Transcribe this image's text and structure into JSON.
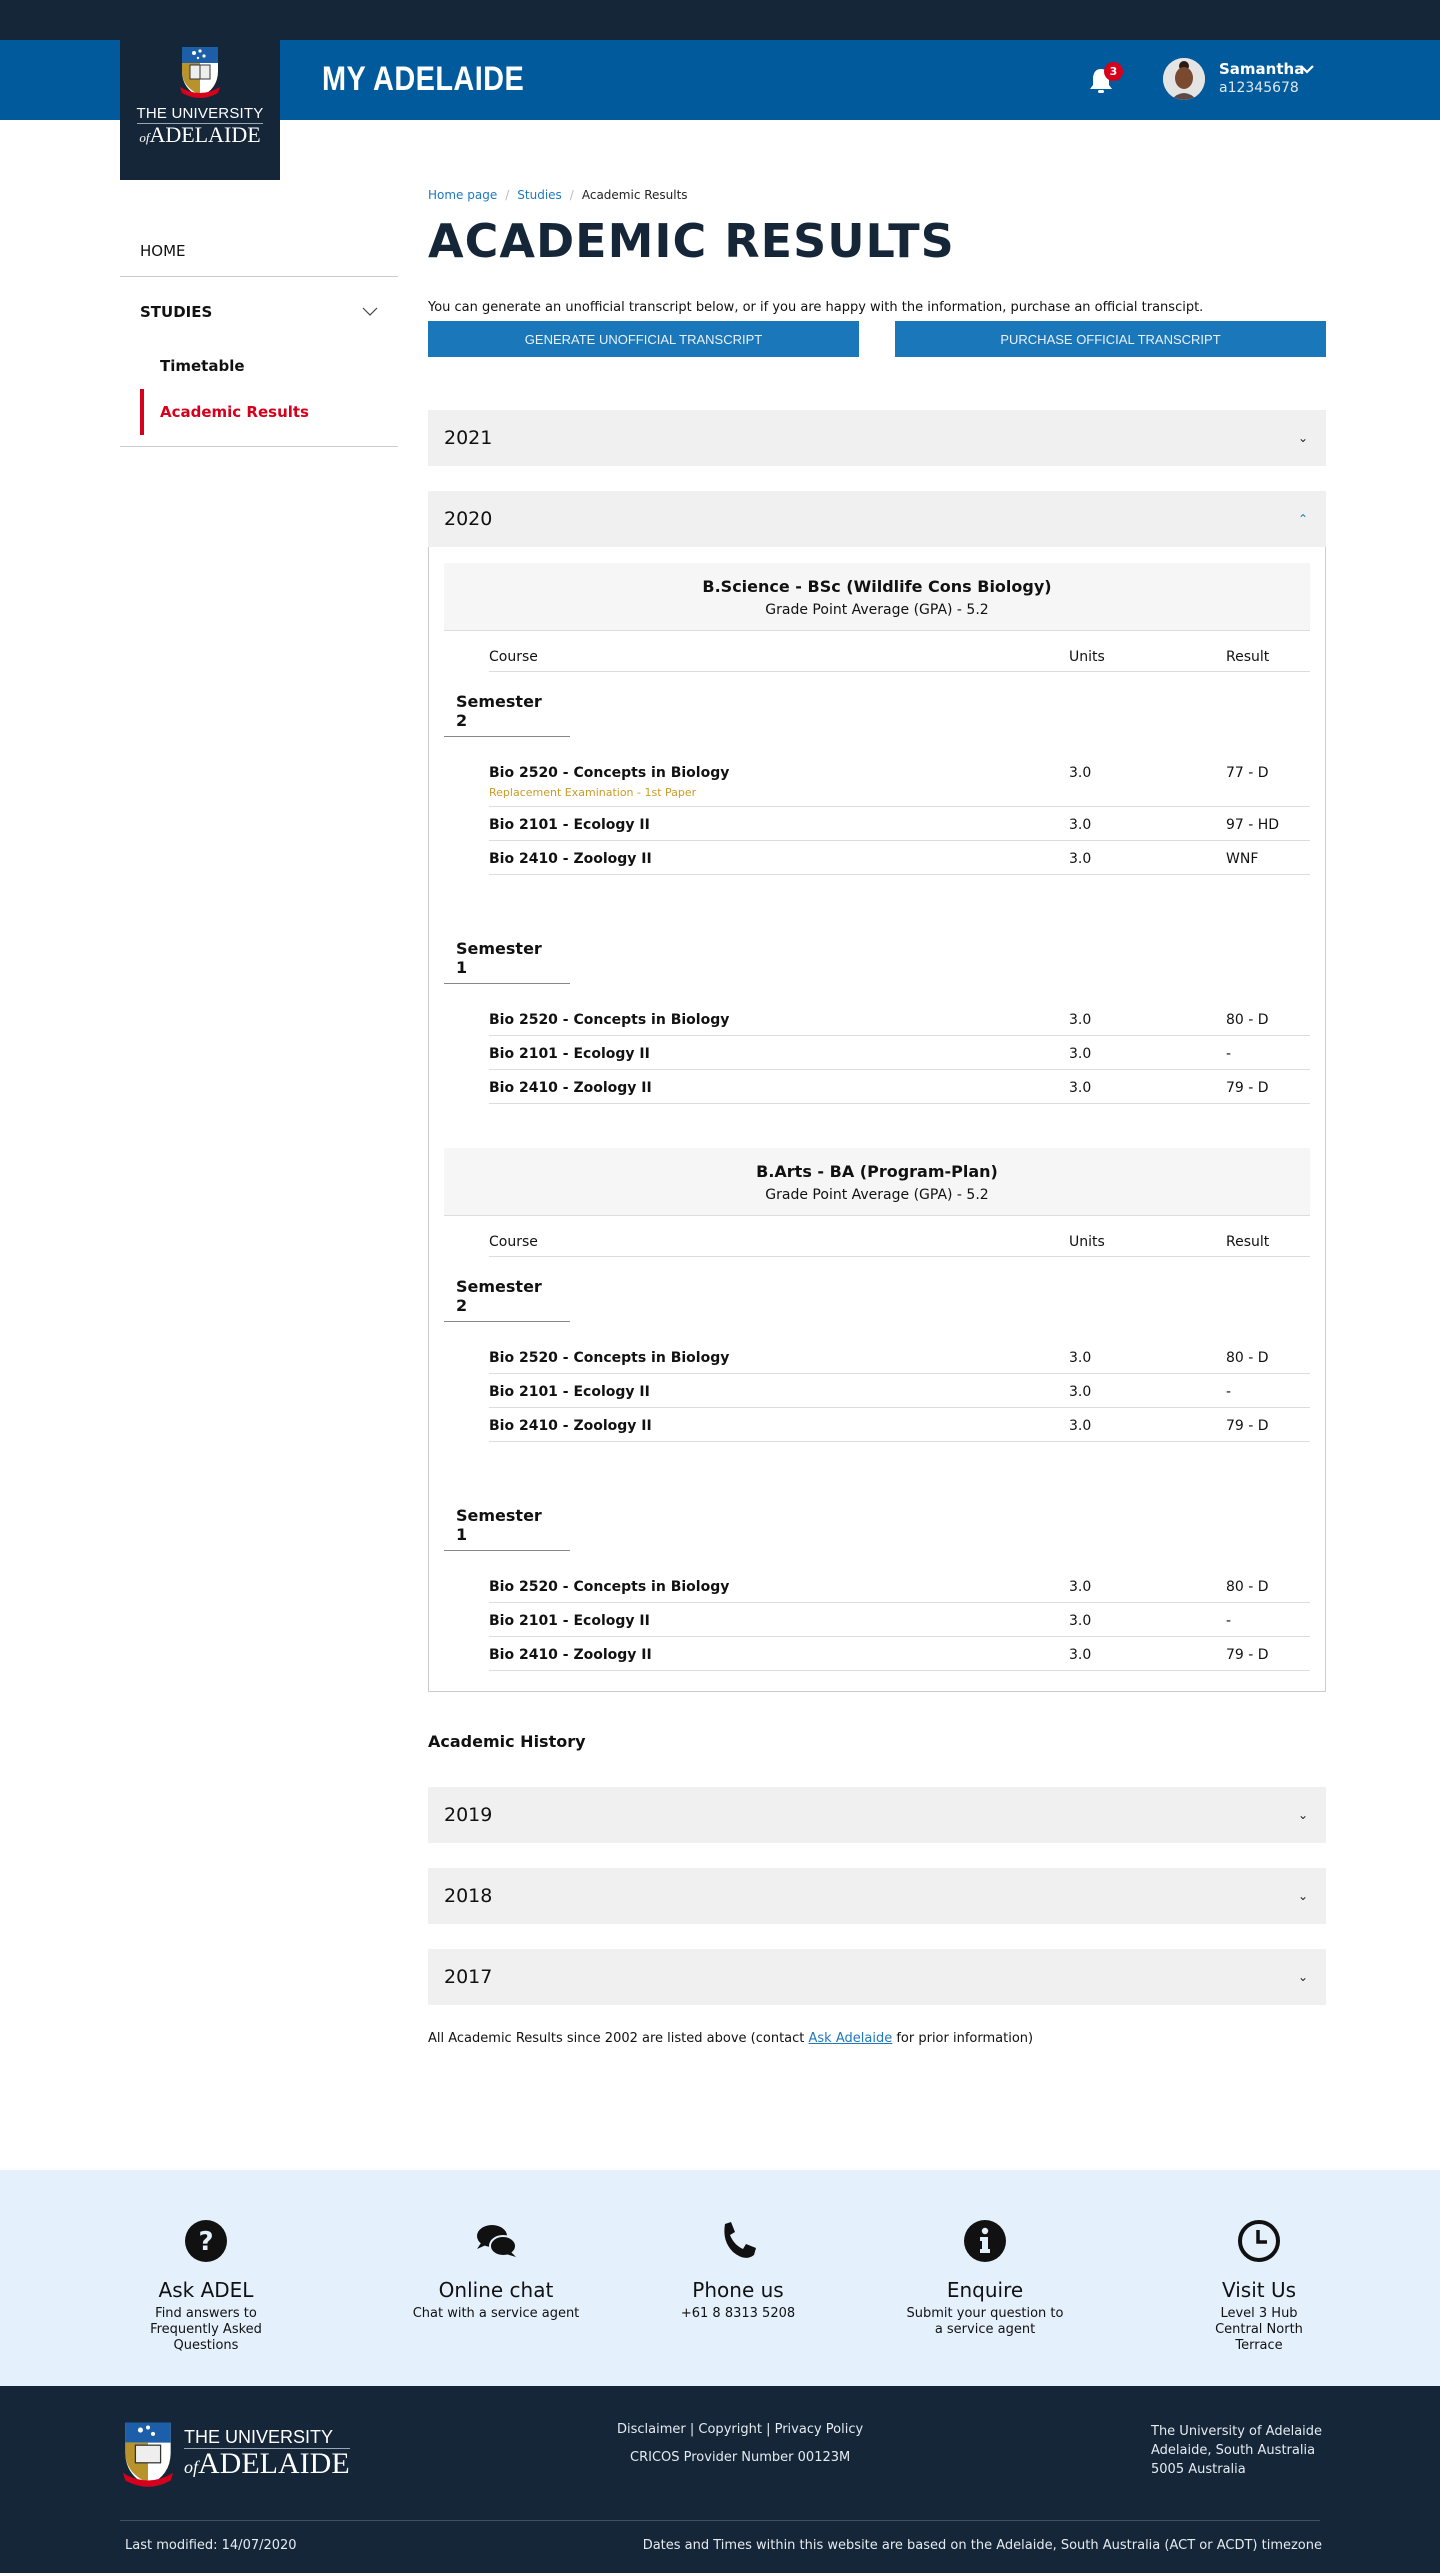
{
  "header": {
    "logo_line1": "THE UNIVERSITY",
    "logo_of": "of",
    "logo_line2": "ADELAIDE",
    "site_title": "MY ADELAIDE",
    "notification_count": "3",
    "user_name": "Samantha",
    "user_id": "a12345678"
  },
  "sidebar": {
    "home": "HOME",
    "studies": "STUDIES",
    "items": [
      {
        "label": "Timetable",
        "active": false
      },
      {
        "label": "Academic Results",
        "active": true
      }
    ]
  },
  "breadcrumb": [
    "Home page",
    "Studies",
    "Academic Results"
  ],
  "page_title": "ACADEMIC RESULTS",
  "intro": "You can generate an unofficial transcript below, or if you are happy with the information, purchase an official transcipt.",
  "buttons": {
    "generate": "GENERATE UNOFFICIAL TRANSCRIPT",
    "purchase": "PURCHASE OFFICIAL TRANSCRIPT"
  },
  "years": {
    "y2021": "2021",
    "y2020": "2020"
  },
  "table_headers": {
    "course": "Course",
    "units": "Units",
    "result": "Result"
  },
  "programs": [
    {
      "name": "B.Science - BSc (Wildlife Cons Biology)",
      "gpa": "Grade Point Average (GPA) - 5.2",
      "semesters": [
        {
          "title": "Semester 2",
          "courses": [
            {
              "name": "Bio 2520 - Concepts in Biology",
              "note": "Replacement Examination - 1st Paper",
              "units": "3.0",
              "result": "77 - D"
            },
            {
              "name": "Bio 2101 - Ecology II",
              "units": "3.0",
              "result": "97 - HD"
            },
            {
              "name": "Bio 2410 - Zoology II",
              "units": "3.0",
              "result": "WNF"
            }
          ]
        },
        {
          "title": "Semester 1",
          "courses": [
            {
              "name": "Bio 2520 - Concepts in Biology",
              "units": "3.0",
              "result": "80 - D"
            },
            {
              "name": "Bio 2101 - Ecology II",
              "units": "3.0",
              "result": "-"
            },
            {
              "name": "Bio 2410 - Zoology II",
              "units": "3.0",
              "result": "79 - D"
            }
          ]
        }
      ]
    },
    {
      "name": "B.Arts - BA (Program-Plan)",
      "gpa": "Grade Point Average (GPA) - 5.2",
      "semesters": [
        {
          "title": "Semester 2",
          "courses": [
            {
              "name": "Bio 2520 - Concepts in Biology",
              "units": "3.0",
              "result": "80 - D"
            },
            {
              "name": "Bio 2101 - Ecology II",
              "units": "3.0",
              "result": "-"
            },
            {
              "name": "Bio 2410 - Zoology II",
              "units": "3.0",
              "result": "79 - D"
            }
          ]
        },
        {
          "title": "Semester 1",
          "courses": [
            {
              "name": "Bio 2520 - Concepts in Biology",
              "units": "3.0",
              "result": "80 - D"
            },
            {
              "name": "Bio 2101 - Ecology II",
              "units": "3.0",
              "result": "-"
            },
            {
              "name": "Bio 2410 - Zoology II",
              "units": "3.0",
              "result": "79 - D"
            }
          ]
        }
      ]
    }
  ],
  "history": {
    "title": "Academic History",
    "years": [
      "2019",
      "2018",
      "2017"
    ],
    "note_before": "All Academic Results since 2002 are listed above (contact ",
    "note_link": "Ask Adelaide",
    "note_after": " for prior information)"
  },
  "help": [
    {
      "icon": "question-circle-icon",
      "title": "Ask ADEL",
      "desc": "Find answers to Frequently Asked Questions"
    },
    {
      "icon": "chat-bubbles-icon",
      "title": "Online chat",
      "desc": "Chat with a service agent"
    },
    {
      "icon": "phone-icon",
      "title": "Phone us",
      "desc": "+61 8 8313 5208"
    },
    {
      "icon": "info-circle-icon",
      "title": "Enquire",
      "desc": "Submit your question to a service agent"
    },
    {
      "icon": "clock-icon",
      "title": "Visit Us",
      "desc": "Level 3 Hub Central North Terrace"
    }
  ],
  "footer": {
    "links": [
      "Disclaimer",
      "Copyright",
      "Privacy Policy"
    ],
    "cricos": "CRICOS Provider Number 00123M",
    "address": [
      "The University of Adelaide",
      "Adelaide, South Australia",
      "5005 Australia"
    ],
    "last_modified": "Last modified: 14/07/2020",
    "timezone": "Dates and Times within this website are based on the Adelaide, South Australia (ACT or ACDT) timezone"
  },
  "colors": {
    "brand_blue": "#005a9c",
    "navy": "#142638",
    "button_blue": "#1a77b9",
    "active_red": "#d6001c",
    "note_gold": "#c89b2a",
    "help_bg": "#e4f0fc"
  }
}
